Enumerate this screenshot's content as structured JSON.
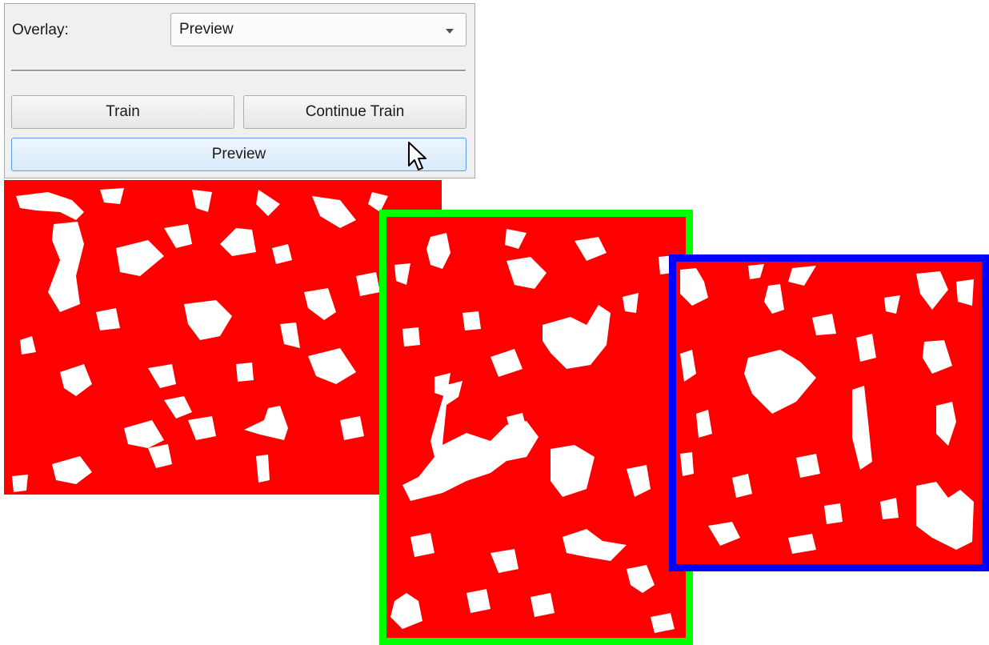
{
  "panel": {
    "overlay_label": "Overlay:",
    "overlay_select": {
      "value": "Preview",
      "icon": "chevron-down-icon"
    },
    "train_button": "Train",
    "continue_train_button": "Continue Train",
    "preview_button": "Preview",
    "cursor_icon": "arrow-cursor-icon"
  },
  "tiles": [
    {
      "name": "segmentation-preview-main",
      "fill_color": "#ff0000",
      "blob_color": "#ffffff"
    },
    {
      "name": "segmentation-preview-green",
      "border_color": "#00ff00",
      "fill_color": "#ff0000",
      "blob_color": "#ffffff"
    },
    {
      "name": "segmentation-preview-blue",
      "border_color": "#0000ff",
      "fill_color": "#ff0000",
      "blob_color": "#ffffff"
    }
  ]
}
